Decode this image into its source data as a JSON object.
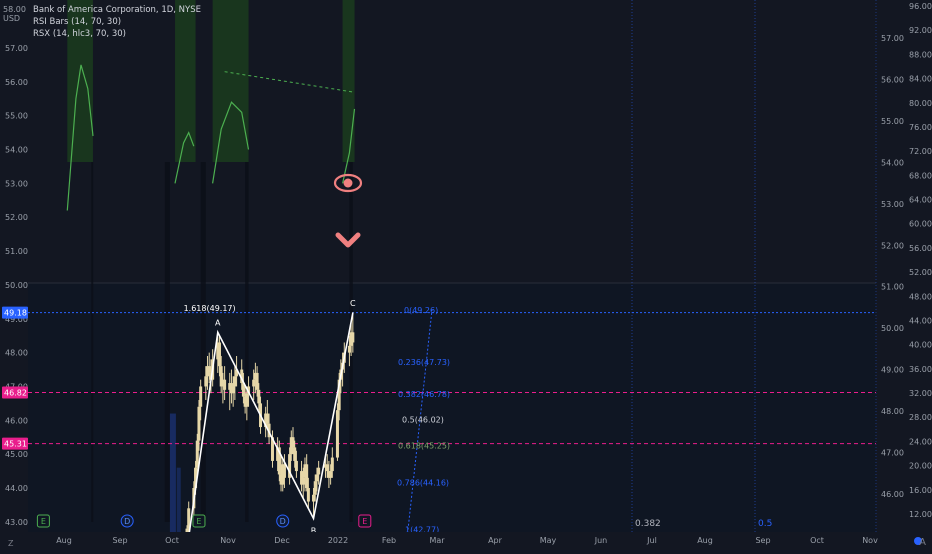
{
  "legend": {
    "title": "Bank of America Corporation, 1D, NYSE",
    "rsi_bars": "RSI Bars (14, 70, 30)",
    "rsx": "RSX (14, hlc3, 70, 30)",
    "currency": "USD",
    "currency_top": "58.00"
  },
  "bottom": {
    "z_label": "Z",
    "auto_label": "A"
  },
  "colors": {
    "background": "#131722",
    "pane_bg": "#0f1623",
    "bar": "#e6d7a8",
    "zigzag": "#ffffff",
    "fib_blue": "#2962ff",
    "fib_green": "#7ea36a",
    "pink": "#e91e8c",
    "rsx_line": "#4caf50",
    "rsi_band": "#1b3a1e",
    "eye_icon": "#f08080"
  },
  "chart_data": {
    "type": "candlestick",
    "title": "Bank of America Corporation, 1D, NYSE",
    "ylim": [
      42.7,
      58.3
    ],
    "x_ticks": [
      "Aug",
      "Sep",
      "Oct",
      "Nov",
      "Dec",
      "2022",
      "Feb",
      "Mar",
      "Apr",
      "May",
      "Jun",
      "Jul",
      "Aug",
      "Sep",
      "Oct",
      "Nov"
    ],
    "left_y_ticks": [
      "43.00",
      "44.00",
      "45.00",
      "46.00",
      "47.00",
      "48.00",
      "49.00",
      "50.00",
      "51.00",
      "52.00",
      "53.00",
      "54.00",
      "55.00",
      "56.00",
      "57.00"
    ],
    "right_y_ticks_outer": [
      "96.00",
      "92.00",
      "88.00",
      "84.00",
      "80.00",
      "76.00",
      "72.00",
      "68.00",
      "64.00",
      "60.00",
      "56.00",
      "52.00",
      "48.00",
      "44.00",
      "40.00",
      "36.00",
      "32.00",
      "28.00",
      "24.00",
      "20.00",
      "16.00",
      "12.00"
    ],
    "right_y_ticks_inner": [
      "57.00",
      "56.00",
      "55.00",
      "54.00",
      "53.00",
      "52.00",
      "51.00",
      "50.00",
      "49.00",
      "48.00",
      "47.00",
      "46.00"
    ],
    "price_badges": [
      {
        "label": "49.18",
        "value": 49.18,
        "color": "#2962ff"
      },
      {
        "label": "46.82",
        "value": 46.82,
        "color": "#e91e8c"
      },
      {
        "label": "45.31",
        "value": 45.31,
        "color": "#e91e8c"
      }
    ],
    "zigzag_points": [
      {
        "label": "",
        "date": "2021-10-07",
        "value": 42.2
      },
      {
        "label": "A",
        "date": "2021-10-25",
        "value": 48.6
      },
      {
        "label": "B",
        "date": "2021-12-20",
        "value": 43.1
      },
      {
        "label": "C",
        "date": "2022-01-12",
        "value": 49.17
      }
    ],
    "fib_levels": [
      {
        "label": "0(49.26)",
        "value": 49.26,
        "color": "#2962ff"
      },
      {
        "label": "0.236(47.73)",
        "value": 47.73,
        "color": "#2962ff"
      },
      {
        "label": "0.382(46.78)",
        "value": 46.78,
        "color": "#2962ff"
      },
      {
        "label": "0.5(46.02)",
        "value": 46.02,
        "color": "#d1d4dc"
      },
      {
        "label": "0.618(45.25)",
        "value": 45.25,
        "color": "#7ea36a"
      },
      {
        "label": "0.786(44.16)",
        "value": 44.16,
        "color": "#2962ff"
      },
      {
        "label": "1(42.77)",
        "value": 42.77,
        "color": "#2962ff"
      }
    ],
    "extension_label": "1.618(49.17)",
    "time_fib": [
      "0.382",
      "0.5"
    ],
    "event_markers": [
      {
        "label": "E",
        "date": "2021-07-15",
        "kind": "earnings"
      },
      {
        "label": "D",
        "date": "2021-09-02",
        "kind": "dividend"
      },
      {
        "label": "E",
        "date": "2021-10-14",
        "kind": "earnings"
      },
      {
        "label": "D",
        "date": "2021-12-02",
        "kind": "dividend"
      },
      {
        "label": "E",
        "date": "2022-01-19",
        "kind": "earnings-upcoming"
      }
    ]
  }
}
